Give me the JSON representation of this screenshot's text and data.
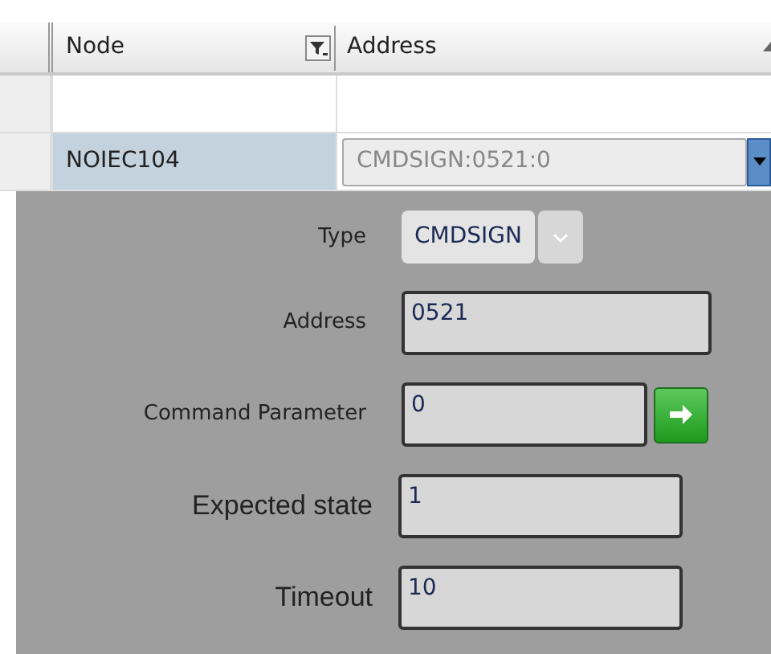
{
  "grid": {
    "columns": [
      {
        "label": "Node",
        "filter": true
      },
      {
        "label": "Address",
        "filter": false
      }
    ],
    "rows": [
      {
        "node": "",
        "address": "",
        "selected": false
      },
      {
        "node": "NOIEC104",
        "address": "CMDSIGN:0521:0",
        "selected": true
      }
    ]
  },
  "editor": {
    "fields": [
      {
        "kind": "combo",
        "label": "Type",
        "value": "CMDSIGN"
      },
      {
        "kind": "text",
        "label": "Address",
        "value": "0521"
      },
      {
        "kind": "action",
        "label": "Command Parameter",
        "value": "0"
      },
      {
        "kind": "legacy",
        "label": "Expected  state",
        "value": "1"
      },
      {
        "kind": "legacy",
        "label": "Timeout",
        "value": "10"
      }
    ]
  }
}
